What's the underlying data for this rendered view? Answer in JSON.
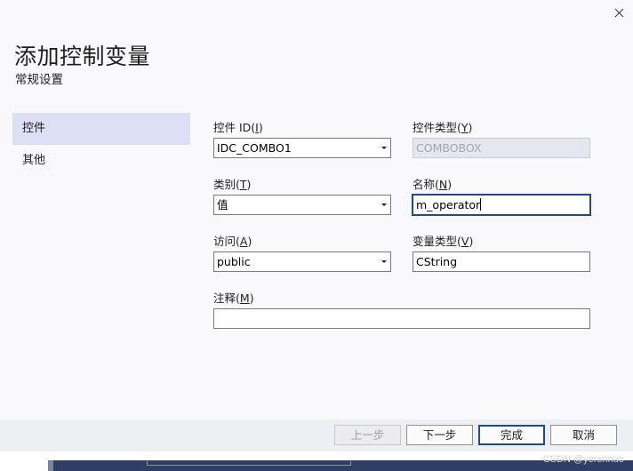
{
  "dialog": {
    "title": "添加控制变量",
    "subtitle": "常规设置",
    "close_icon": "close-icon"
  },
  "nav": {
    "items": [
      {
        "label": "控件",
        "selected": true
      },
      {
        "label": "其他",
        "selected": false
      }
    ]
  },
  "fields": {
    "control_id": {
      "label": "控件 ID(",
      "key": "I",
      "label_end": ")",
      "value": "IDC_COMBO1"
    },
    "control_type": {
      "label": "控件类型(",
      "key": "Y",
      "label_end": ")",
      "value": "COMBOBOX"
    },
    "category": {
      "label": "类别(",
      "key": "T",
      "label_end": ")",
      "value": "值"
    },
    "name": {
      "label": "名称(",
      "key": "N",
      "label_end": ")",
      "value": "m_operator"
    },
    "access": {
      "label": "访问(",
      "key": "A",
      "label_end": ")",
      "value": "public"
    },
    "var_type": {
      "label": "变量类型(",
      "key": "V",
      "label_end": ")",
      "value": "CString"
    },
    "comment": {
      "label": "注释(",
      "key": "M",
      "label_end": ")",
      "value": ""
    }
  },
  "buttons": {
    "prev": "上一步",
    "next": "下一步",
    "finish": "完成",
    "cancel": "取消"
  },
  "watermark": "CSDN @yerennuo",
  "colors": {
    "nav_selected": "#dcdff5",
    "focus_border": "#1c4a8a",
    "dialog_bg": "#f9f9fb"
  }
}
